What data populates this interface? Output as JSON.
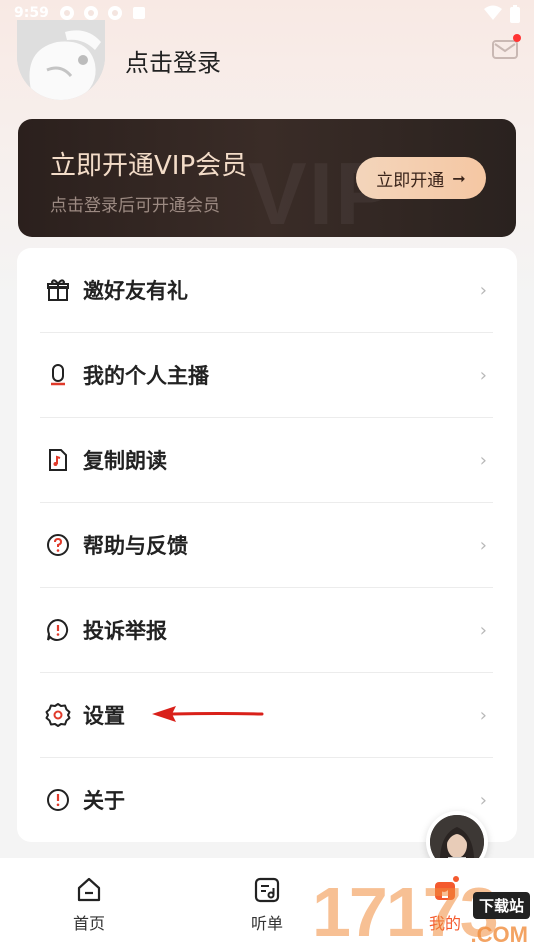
{
  "status_bar": {
    "time": "9:59"
  },
  "profile": {
    "login_text": "点击登录"
  },
  "vip": {
    "title": "立即开通VIP会员",
    "subtitle": "点击登录后可开通会员",
    "button_label": "立即开通",
    "watermark": "VIP"
  },
  "menu": {
    "items": [
      {
        "label": "邀好友有礼",
        "icon": "gift-icon"
      },
      {
        "label": "我的个人主播",
        "icon": "microphone-icon"
      },
      {
        "label": "复制朗读",
        "icon": "music-doc-icon"
      },
      {
        "label": "帮助与反馈",
        "icon": "question-icon"
      },
      {
        "label": "投诉举报",
        "icon": "report-icon"
      },
      {
        "label": "设置",
        "icon": "gear-icon"
      },
      {
        "label": "关于",
        "icon": "info-icon"
      }
    ]
  },
  "tabs": [
    {
      "label": "首页",
      "icon": "home-icon"
    },
    {
      "label": "听单",
      "icon": "playlist-icon"
    },
    {
      "label": "我的",
      "icon": "profile-icon",
      "active": true
    }
  ],
  "watermark": {
    "number": "17173",
    "badge": "下载站",
    "com": ".COM"
  },
  "colors": {
    "accent": "#f45a2e",
    "vip_bg": "#2b201d",
    "vip_text": "#f3dcc8",
    "arrow": "#d9201a"
  }
}
